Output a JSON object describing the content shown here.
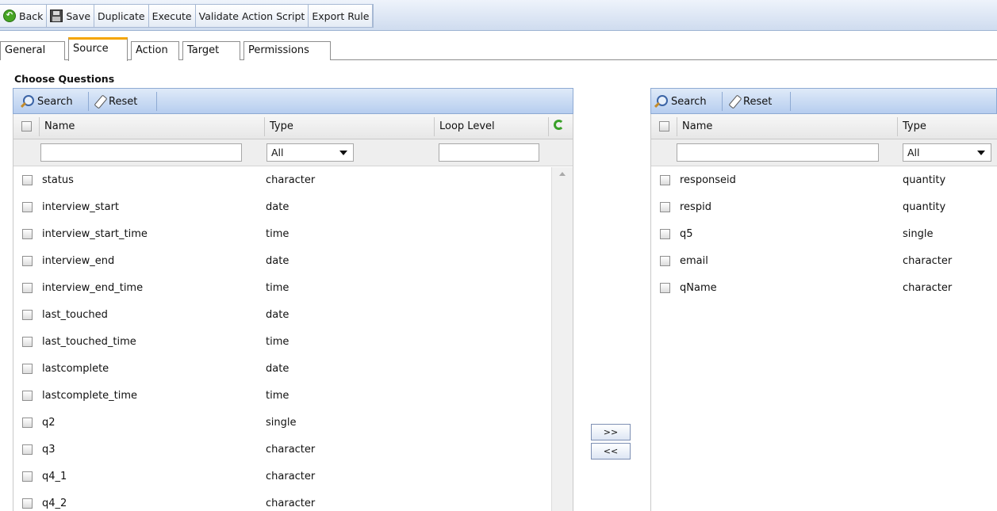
{
  "toolbar": {
    "back": "Back",
    "save": "Save",
    "duplicate": "Duplicate",
    "execute": "Execute",
    "validate": "Validate Action Script",
    "export": "Export Rule"
  },
  "tabs": [
    "General",
    "Source",
    "Action",
    "Target",
    "Permissions"
  ],
  "active_tab": "Source",
  "section_title": "Choose Questions",
  "left_panel": {
    "search_label": "Search",
    "reset_label": "Reset",
    "columns": {
      "name": "Name",
      "type": "Type",
      "loop_level": "Loop Level"
    },
    "type_filter": "All",
    "rows": [
      {
        "name": "status",
        "type": "character"
      },
      {
        "name": "interview_start",
        "type": "date"
      },
      {
        "name": "interview_start_time",
        "type": "time"
      },
      {
        "name": "interview_end",
        "type": "date"
      },
      {
        "name": "interview_end_time",
        "type": "time"
      },
      {
        "name": "last_touched",
        "type": "date"
      },
      {
        "name": "last_touched_time",
        "type": "time"
      },
      {
        "name": "lastcomplete",
        "type": "date"
      },
      {
        "name": "lastcomplete_time",
        "type": "time"
      },
      {
        "name": "q2",
        "type": "single"
      },
      {
        "name": "q3",
        "type": "character"
      },
      {
        "name": "q4_1",
        "type": "character"
      },
      {
        "name": "q4_2",
        "type": "character"
      }
    ]
  },
  "move_buttons": {
    "add": ">>",
    "remove": "<<"
  },
  "right_panel": {
    "search_label": "Search",
    "reset_label": "Reset",
    "columns": {
      "name": "Name",
      "type": "Type"
    },
    "type_filter": "All",
    "rows": [
      {
        "name": "responseid",
        "type": "quantity"
      },
      {
        "name": "respid",
        "type": "quantity"
      },
      {
        "name": "q5",
        "type": "single"
      },
      {
        "name": "email",
        "type": "character"
      },
      {
        "name": "qName",
        "type": "character"
      }
    ]
  }
}
